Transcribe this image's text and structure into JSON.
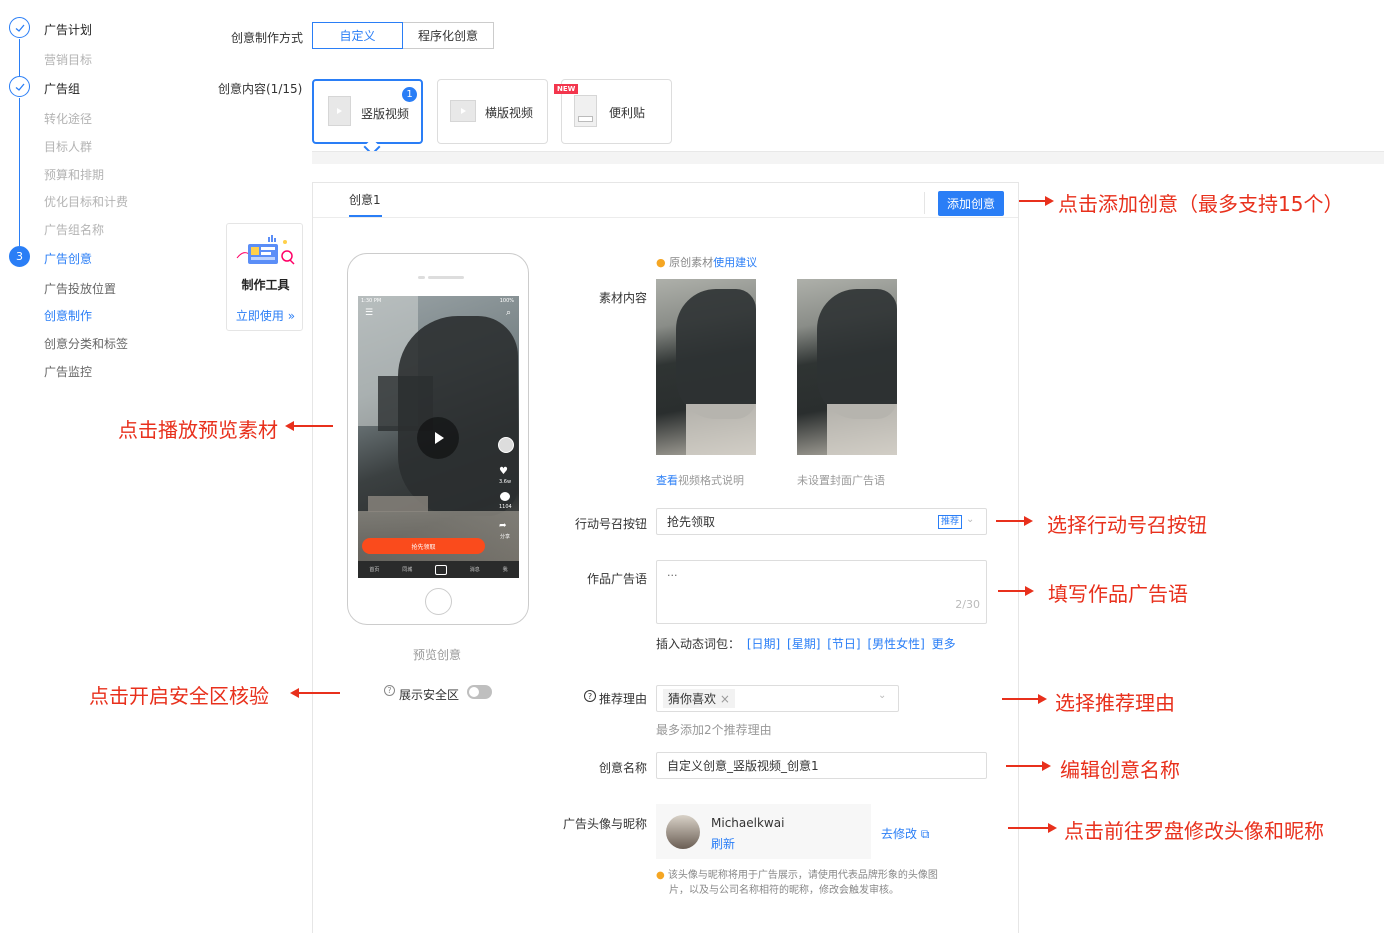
{
  "sidebar": {
    "step1": {
      "num": "",
      "title": "广告计划",
      "items": [
        "营销目标"
      ]
    },
    "step2": {
      "num": "",
      "title": "广告组",
      "items": [
        "转化途径",
        "目标人群",
        "预算和排期",
        "优化目标和计费",
        "广告组名称"
      ]
    },
    "step3": {
      "num": "3",
      "title": "广告创意",
      "items": [
        "广告投放位置",
        "创意制作",
        "创意分类和标签",
        "广告监控"
      ]
    }
  },
  "tool_card": {
    "title": "制作工具",
    "link": "立即使用 »"
  },
  "creative_method": {
    "label": "创意制作方式",
    "options": [
      "自定义",
      "程序化创意"
    ],
    "selected": "自定义"
  },
  "creative_content": {
    "label": "创意内容(1/15)",
    "formats": [
      {
        "name": "竖版视频",
        "badge": "1"
      },
      {
        "name": "横版视频"
      },
      {
        "name": "便利贴",
        "tag": "NEW"
      }
    ]
  },
  "panel": {
    "tab": "创意1",
    "add_button": "添加创意",
    "tip_prefix": "原创素材",
    "tip_link": "使用建议",
    "material_label": "素材内容",
    "material_link": "查看",
    "material_link_rest": "视频格式说明",
    "cover_note": "未设置封面广告语",
    "preview_label": "预览创意",
    "safe_zone_label": "展示安全区",
    "cta": {
      "label": "行动号召按钮",
      "value": "抢先领取",
      "tag": "推荐"
    },
    "ad_text": {
      "label": "作品广告语",
      "value": "···",
      "counter": "2/30"
    },
    "insert": {
      "label": "插入动态词包：",
      "tags": [
        "[日期]",
        "[星期]",
        "[节日]",
        "[男性女性]"
      ],
      "more": "更多"
    },
    "reason": {
      "label": "推荐理由",
      "chip": "猜你喜欢",
      "hint": "最多添加2个推荐理由"
    },
    "name": {
      "label": "创意名称",
      "value": "自定义创意_竖版视频_创意1"
    },
    "avatar": {
      "label": "广告头像与昵称",
      "nickname": "Michaelkwai",
      "refresh": "刷新",
      "edit": "去修改",
      "note_line1": "该头像与昵称将用于广告展示，请使用代表品牌形象的头像图",
      "note_line2": "片，以及与公司名称相符的昵称，修改会触发审核。"
    }
  },
  "phone": {
    "cta_button": "抢先领取",
    "status_time": "1:30 PM",
    "battery": "100%",
    "like_count": "3.6w",
    "comment_count": "1104",
    "share_label": "分享",
    "nav": [
      "首页",
      "同城",
      "",
      "消息",
      "我"
    ]
  },
  "annotations": {
    "add": "点击添加创意（最多支持15个）",
    "play": "点击播放预览素材",
    "cta": "选择行动号召按钮",
    "text": "填写作品广告语",
    "safe": "点击开启安全区核验",
    "reason": "选择推荐理由",
    "name": "编辑创意名称",
    "avatar": "点击前往罗盘修改头像和昵称"
  },
  "colors": {
    "accent": "#2a7ef6",
    "annotation": "#e8301c"
  }
}
